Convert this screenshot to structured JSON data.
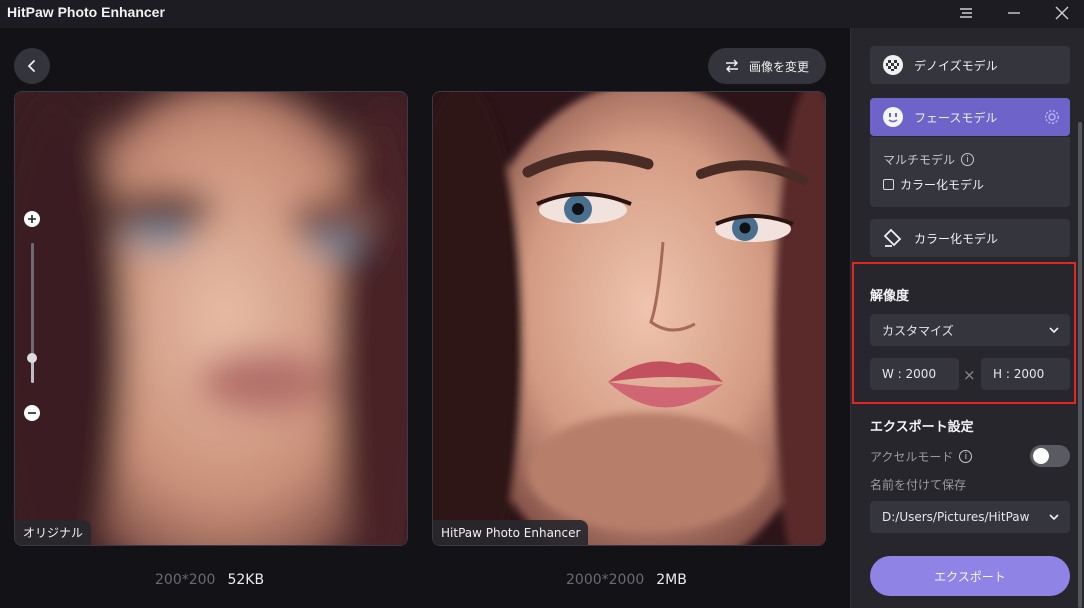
{
  "app": {
    "title": "HitPaw Photo Enhancer"
  },
  "toolbar": {
    "change_image_label": "画像を変更"
  },
  "original": {
    "tag": "オリジナル",
    "dimensions": "200*200",
    "size": "52KB"
  },
  "enhanced": {
    "tag": "HitPaw Photo Enhancer",
    "dimensions": "2000*2000",
    "size": "2MB"
  },
  "zoom": {
    "level": 0.18
  },
  "models": {
    "denoise": "デノイズモデル",
    "face": "フェースモデル",
    "multi_label": "マルチモデル",
    "colorize_checkbox": "カラー化モデル",
    "colorize": "カラー化モデル"
  },
  "resolution": {
    "title": "解像度",
    "preset": "カスタマイズ",
    "width": "W : 2000",
    "height": "H : 2000",
    "times": "×"
  },
  "export": {
    "title": "エクスポート設定",
    "accel_label": "アクセルモード",
    "accel_on": false,
    "save_label": "名前を付けて保存",
    "path": "D:/Users/Pictures/HitPaw",
    "button": "エクスポート"
  },
  "colors": {
    "accent": "#6d63c9",
    "export_button": "#8f83e6",
    "highlight_border": "#e1271e"
  }
}
